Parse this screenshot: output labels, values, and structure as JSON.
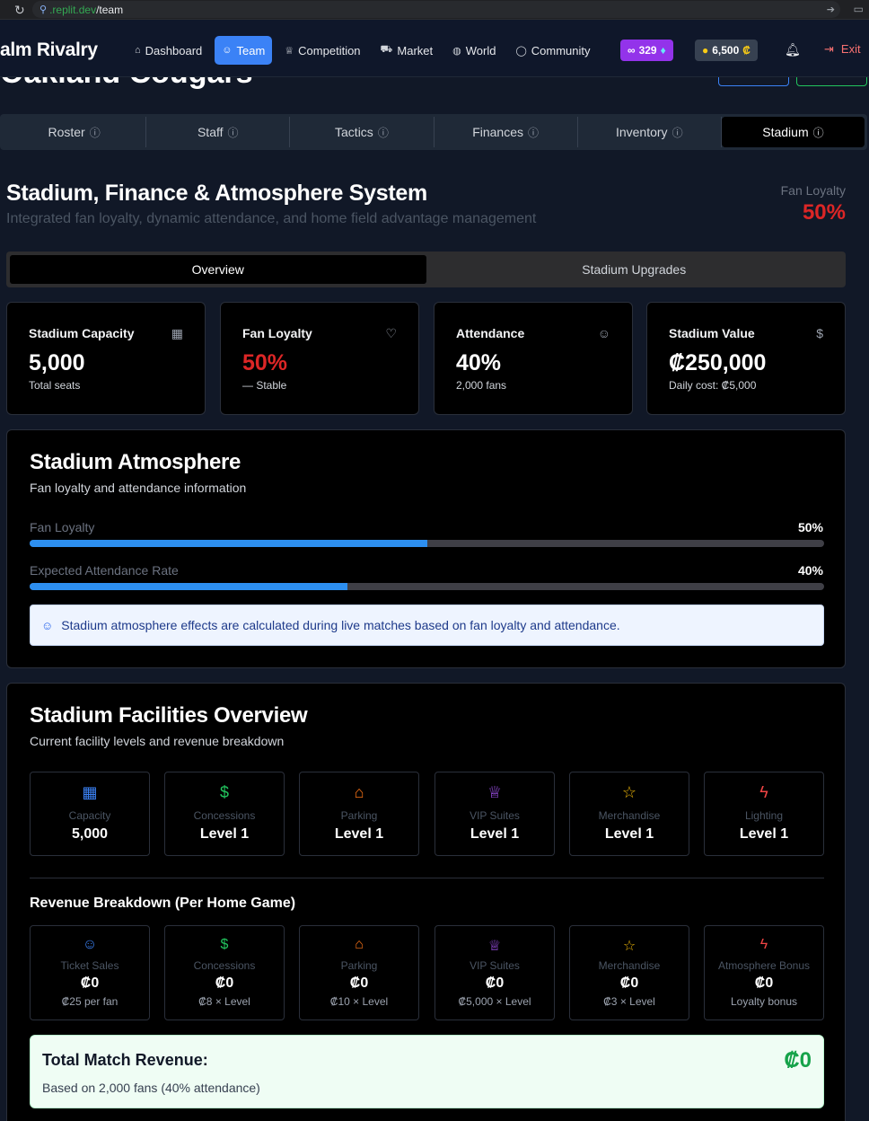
{
  "browser": {
    "url_domain": ".replit.dev",
    "url_path": "/team"
  },
  "header": {
    "brand": "alm Rivalry",
    "nav": [
      {
        "label": "Dashboard",
        "icon": "home-icon"
      },
      {
        "label": "Team",
        "icon": "users-icon",
        "active": true
      },
      {
        "label": "Competition",
        "icon": "trophy-icon"
      },
      {
        "label": "Market",
        "icon": "cart-icon"
      },
      {
        "label": "World",
        "icon": "globe-icon"
      },
      {
        "label": "Community",
        "icon": "chat-icon"
      }
    ],
    "gems": "329",
    "coins": "6,500",
    "coin_symbol": "₡",
    "exit_label": "Exit"
  },
  "team_name": "Oakland Cougars",
  "main_tabs": [
    {
      "label": "Roster"
    },
    {
      "label": "Staff"
    },
    {
      "label": "Tactics"
    },
    {
      "label": "Finances"
    },
    {
      "label": "Inventory"
    },
    {
      "label": "Stadium",
      "active": true
    }
  ],
  "page": {
    "title": "Stadium, Finance & Atmosphere System",
    "subtitle": "Integrated fan loyalty, dynamic attendance, and home field advantage management",
    "loyalty_label": "Fan Loyalty",
    "loyalty_value": "50%"
  },
  "sub_tabs": [
    {
      "label": "Overview",
      "active": true
    },
    {
      "label": "Stadium Upgrades"
    }
  ],
  "stats": [
    {
      "label": "Stadium Capacity",
      "icon": "building-icon",
      "value": "5,000",
      "sub": "Total seats"
    },
    {
      "label": "Fan Loyalty",
      "icon": "heart-icon",
      "value": "50%",
      "sub": "— Stable"
    },
    {
      "label": "Attendance",
      "icon": "users-icon",
      "value": "40%",
      "sub": "2,000 fans"
    },
    {
      "label": "Stadium Value",
      "icon": "dollar-icon",
      "value": "₡250,000",
      "sub": "Daily cost: ₡5,000"
    }
  ],
  "atmosphere": {
    "title": "Stadium Atmosphere",
    "subtitle": "Fan loyalty and attendance information",
    "bars": [
      {
        "label": "Fan Loyalty",
        "pct_text": "50%",
        "fraction": 0.5
      },
      {
        "label": "Expected Attendance Rate",
        "pct_text": "40%",
        "fraction": 0.4
      }
    ],
    "info": "Stadium atmosphere effects are calculated during live matches based on fan loyalty and attendance."
  },
  "facilities": {
    "title": "Stadium Facilities Overview",
    "subtitle": "Current facility levels and revenue breakdown",
    "items": [
      {
        "name": "Capacity",
        "value": "5,000",
        "icon": "building-icon"
      },
      {
        "name": "Concessions",
        "value": "Level 1",
        "icon": "dollar-icon"
      },
      {
        "name": "Parking",
        "value": "Level 1",
        "icon": "home-icon"
      },
      {
        "name": "VIP Suites",
        "value": "Level 1",
        "icon": "trophy-icon"
      },
      {
        "name": "Merchandise",
        "value": "Level 1",
        "icon": "star-icon"
      },
      {
        "name": "Lighting",
        "value": "Level 1",
        "icon": "bolt-icon"
      }
    ]
  },
  "revenue": {
    "title": "Revenue Breakdown (Per Home Game)",
    "items": [
      {
        "name": "Ticket Sales",
        "value": "₡0",
        "note": "₡25 per fan",
        "icon": "users-icon"
      },
      {
        "name": "Concessions",
        "value": "₡0",
        "note": "₡8 × Level",
        "icon": "dollar-icon"
      },
      {
        "name": "Parking",
        "value": "₡0",
        "note": "₡10 × Level",
        "icon": "home-icon"
      },
      {
        "name": "VIP Suites",
        "value": "₡0",
        "note": "₡5,000 × Level",
        "icon": "trophy-icon"
      },
      {
        "name": "Merchandise",
        "value": "₡0",
        "note": "₡3 × Level",
        "icon": "star-icon"
      },
      {
        "name": "Atmosphere Bonus",
        "value": "₡0",
        "note": "Loyalty bonus",
        "icon": "bolt-icon"
      }
    ],
    "total_label": "Total Match Revenue:",
    "total_value": "₡0",
    "total_note": "Based on 2,000 fans (40% attendance)"
  }
}
